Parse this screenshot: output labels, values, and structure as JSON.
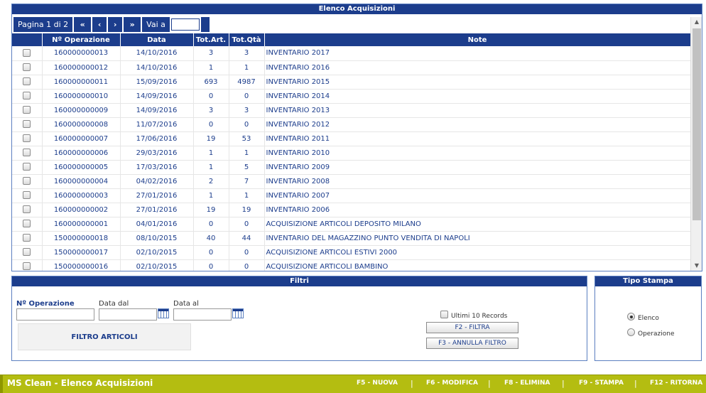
{
  "main": {
    "title": "Elenco Acquisizioni",
    "pager": {
      "page_label": "Pagina 1 di 2",
      "first": "«",
      "prev": "‹",
      "next": "›",
      "last": "»",
      "goto_label": "Vai a",
      "goto_value": ""
    },
    "columns": [
      "Nº Operazione",
      "Data",
      "Tot.Art.",
      "Tot.Qtà",
      "Note"
    ],
    "rows": [
      {
        "op": "160000000013",
        "data": "14/10/2016",
        "art": "3",
        "qta": "3",
        "note": "INVENTARIO 2017"
      },
      {
        "op": "160000000012",
        "data": "14/10/2016",
        "art": "1",
        "qta": "1",
        "note": "INVENTARIO 2016"
      },
      {
        "op": "160000000011",
        "data": "15/09/2016",
        "art": "693",
        "qta": "4987",
        "note": "INVENTARIO 2015"
      },
      {
        "op": "160000000010",
        "data": "14/09/2016",
        "art": "0",
        "qta": "0",
        "note": "INVENTARIO 2014"
      },
      {
        "op": "160000000009",
        "data": "14/09/2016",
        "art": "3",
        "qta": "3",
        "note": "INVENTARIO 2013"
      },
      {
        "op": "160000000008",
        "data": "11/07/2016",
        "art": "0",
        "qta": "0",
        "note": "INVENTARIO 2012"
      },
      {
        "op": "160000000007",
        "data": "17/06/2016",
        "art": "19",
        "qta": "53",
        "note": "INVENTARIO 2011"
      },
      {
        "op": "160000000006",
        "data": "29/03/2016",
        "art": "1",
        "qta": "1",
        "note": "INVENTARIO 2010"
      },
      {
        "op": "160000000005",
        "data": "17/03/2016",
        "art": "1",
        "qta": "5",
        "note": "INVENTARIO 2009"
      },
      {
        "op": "160000000004",
        "data": "04/02/2016",
        "art": "2",
        "qta": "7",
        "note": "INVENTARIO 2008"
      },
      {
        "op": "160000000003",
        "data": "27/01/2016",
        "art": "1",
        "qta": "1",
        "note": "INVENTARIO 2007"
      },
      {
        "op": "160000000002",
        "data": "27/01/2016",
        "art": "19",
        "qta": "19",
        "note": "INVENTARIO 2006"
      },
      {
        "op": "160000000001",
        "data": "04/01/2016",
        "art": "0",
        "qta": "0",
        "note": "ACQUISIZIONE ARTICOLI DEPOSITO MILANO"
      },
      {
        "op": "150000000018",
        "data": "08/10/2015",
        "art": "40",
        "qta": "44",
        "note": "INVENTARIO DEL MAGAZZINO PUNTO VENDITA DI NAPOLI"
      },
      {
        "op": "150000000017",
        "data": "02/10/2015",
        "art": "0",
        "qta": "0",
        "note": "ACQUISIZIONE ARTICOLI ESTIVI 2000"
      },
      {
        "op": "150000000016",
        "data": "02/10/2015",
        "art": "0",
        "qta": "0",
        "note": "ACQUISIZIONE  ARTICOLI BAMBINO"
      }
    ]
  },
  "filters": {
    "title": "Filtri",
    "op_label": "Nº Operazione",
    "date_from_label": "Data dal",
    "date_to_label": "Data al",
    "op_value": "",
    "date_from_value": "",
    "date_to_value": "",
    "filtro_articoli": "FILTRO ARTICOLI",
    "last10_label": "Ultimi 10 Records",
    "filtra_button": "F2 - FILTRA",
    "annulla_button": "F3 - ANNULLA FILTRO"
  },
  "print": {
    "title": "Tipo Stampa",
    "options": [
      {
        "label": "Elenco",
        "selected": true
      },
      {
        "label": "Operazione",
        "selected": false
      }
    ]
  },
  "footer": {
    "app_title": "MS Clean - Elenco Acquisizioni",
    "keys": [
      "F5 - NUOVA",
      "F6 - MODIFICA",
      "F8 - ELIMINA",
      "F9 - STAMPA",
      "F12 - RITORNA"
    ],
    "separator": "|"
  }
}
